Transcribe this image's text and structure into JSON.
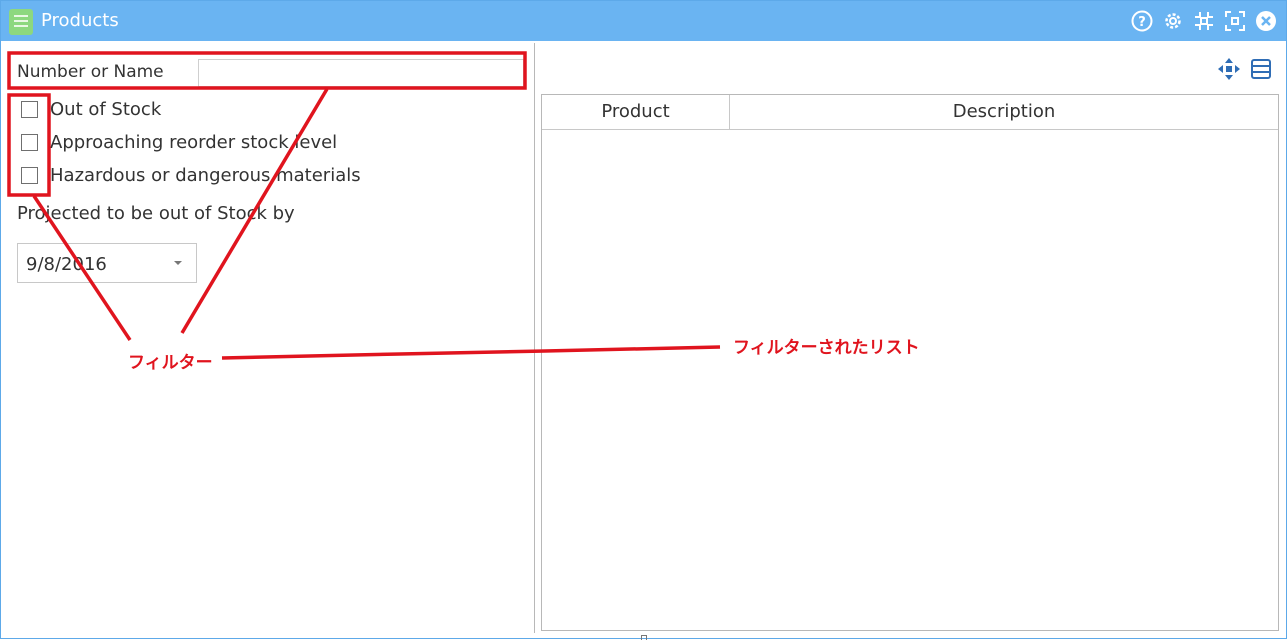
{
  "window": {
    "title": "Products",
    "app_icon": "notebook-icon",
    "title_buttons": [
      "help-icon",
      "gear-icon",
      "restore-icon",
      "maximize-icon",
      "close-icon"
    ],
    "titlebar_color": "#6ab4f2"
  },
  "filters": {
    "search_label": "Number or Name",
    "search_value": "",
    "checkboxes": [
      {
        "label": "Out of Stock",
        "checked": false
      },
      {
        "label": "Approaching reorder stock level",
        "checked": false
      },
      {
        "label": "Hazardous or dangerous materials",
        "checked": false
      }
    ],
    "projected_label": "Projected to be out of Stock by",
    "projected_date": "9/8/2016"
  },
  "grid": {
    "toolbar_icons": [
      "move-icon",
      "menu-icon"
    ],
    "columns": [
      "Product",
      "Description"
    ],
    "rows": []
  },
  "annotations": {
    "filter_label": "フィルター",
    "list_label": "フィルターされたリスト",
    "color": "#e0141e"
  }
}
